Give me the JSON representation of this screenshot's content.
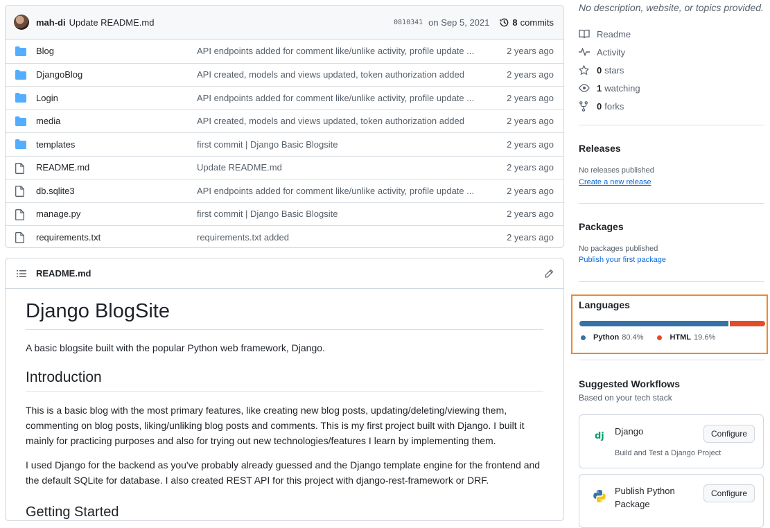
{
  "commit": {
    "author": "mah-di",
    "message": "Update README.md",
    "sha": "0810341",
    "date": "on Sep 5, 2021",
    "commits_count": "8",
    "commits_label": "commits"
  },
  "files": [
    {
      "name": "Blog",
      "type": "folder",
      "message": "API endpoints added for comment like/unlike activity, profile update ...",
      "age": "2 years ago"
    },
    {
      "name": "DjangoBlog",
      "type": "folder",
      "message": "API created, models and views updated, token authorization added",
      "age": "2 years ago"
    },
    {
      "name": "Login",
      "type": "folder",
      "message": "API endpoints added for comment like/unlike activity, profile update ...",
      "age": "2 years ago"
    },
    {
      "name": "media",
      "type": "folder",
      "message": "API created, models and views updated, token authorization added",
      "age": "2 years ago"
    },
    {
      "name": "templates",
      "type": "folder",
      "message": "first commit | Django Basic Blogsite",
      "age": "2 years ago"
    },
    {
      "name": "README.md",
      "type": "file",
      "message": "Update README.md",
      "age": "2 years ago"
    },
    {
      "name": "db.sqlite3",
      "type": "file",
      "message": "API endpoints added for comment like/unlike activity, profile update ...",
      "age": "2 years ago"
    },
    {
      "name": "manage.py",
      "type": "file",
      "message": "first commit | Django Basic Blogsite",
      "age": "2 years ago"
    },
    {
      "name": "requirements.txt",
      "type": "file",
      "message": "requirements.txt added",
      "age": "2 years ago"
    }
  ],
  "readme": {
    "filename": "README.md",
    "title": "Django BlogSite",
    "intro": "A basic blogsite built with the popular Python web framework, Django.",
    "h2": "Introduction",
    "p1": "This is a basic blog with the most primary features, like creating new blog posts, updating/deleting/viewing them, commenting on blog posts, liking/unliking blog posts and comments. This is my first project built with Django. I built it mainly for practicing purposes and also for trying out new technologies/features I learn by implementing them.",
    "p2": "I used Django for the backend as you've probably already guessed and the Django template engine for the frontend and the default SQLite for database. I also created REST API for this project with django-rest-framework or DRF.",
    "h3": "Getting Started"
  },
  "sidebar": {
    "about": "No description, website, or topics provided.",
    "readme_label": "Readme",
    "activity_label": "Activity",
    "stars_count": "0",
    "stars_label": "stars",
    "watching_count": "1",
    "watching_label": "watching",
    "forks_count": "0",
    "forks_label": "forks",
    "releases_title": "Releases",
    "releases_none": "No releases published",
    "releases_link": "Create a new release",
    "packages_title": "Packages",
    "packages_none": "No packages published",
    "packages_link": "Publish your first package",
    "languages_title": "Languages",
    "languages": [
      {
        "name": "Python",
        "percent": "80.4%",
        "color": "#3572A5"
      },
      {
        "name": "HTML",
        "percent": "19.6%",
        "color": "#e34c26"
      }
    ],
    "workflows_title": "Suggested Workflows",
    "workflows_subtitle": "Based on your tech stack",
    "workflows": [
      {
        "name": "Django",
        "desc": "Build and Test a Django Project",
        "button": "Configure",
        "logo": "django-logo"
      },
      {
        "name": "Publish Python Package",
        "desc": "",
        "button": "Configure",
        "logo": "python-logo"
      }
    ]
  },
  "colors": {
    "folder": "#54aeff",
    "link": "#0969da",
    "highlight_border": "#f0872d"
  }
}
